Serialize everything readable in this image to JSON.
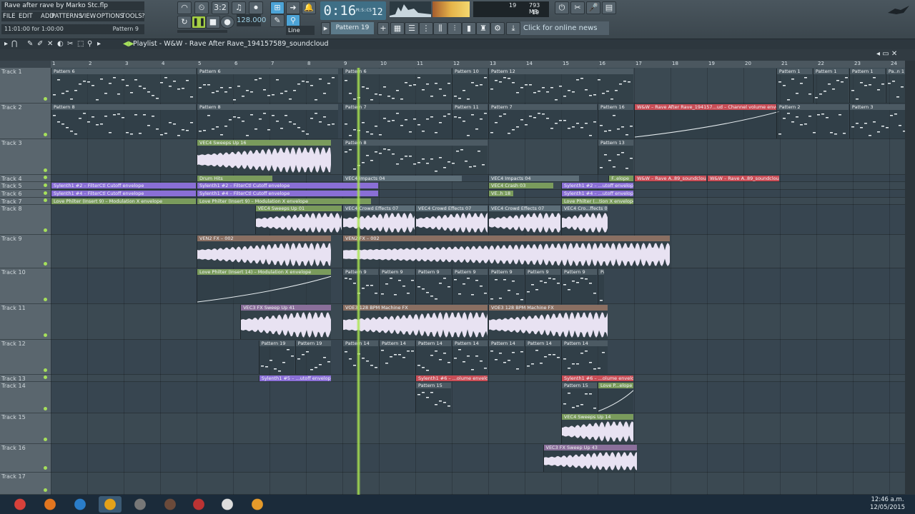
{
  "app": {
    "title": "Rave after rave by Marko Stc.flp",
    "menu": [
      "FILE",
      "EDIT",
      "ADD",
      "PATTERNS",
      "VIEW",
      "OPTIONS",
      "TOOLS",
      "?"
    ],
    "hint_time": "11:01:00 for 1:00:00",
    "hint_pattern": "Pattern 9",
    "time": "0:16",
    "time_frac": "12",
    "time_unit": "M:S:CS",
    "tempo": "128.000",
    "snap": "Line",
    "pattern_selector": "Pattern 19",
    "cpu_value": "19",
    "ram_value": "793 MB",
    "poly_value": "19",
    "news": "Click for online news",
    "step_label": "3:2"
  },
  "playlist": {
    "title": "Playlist - W&W - Rave After Rave_194157589_soundcloud",
    "ruler": [
      "1",
      "2",
      "3",
      "4",
      "5",
      "6",
      "7",
      "8",
      "9",
      "10",
      "11",
      "12",
      "13",
      "14",
      "15",
      "16",
      "17",
      "18",
      "19",
      "20",
      "21",
      "22",
      "23",
      "24"
    ],
    "tracks": [
      {
        "label": "Track 1"
      },
      {
        "label": "Track 2"
      },
      {
        "label": "Track 3"
      },
      {
        "label": "Track 4"
      },
      {
        "label": "Track 5"
      },
      {
        "label": "Track 6"
      },
      {
        "label": "Track 7"
      },
      {
        "label": "Track 8"
      },
      {
        "label": "Track 9"
      },
      {
        "label": "Track 10"
      },
      {
        "label": "Track 11"
      },
      {
        "label": "Track 12"
      },
      {
        "label": "Track 13"
      },
      {
        "label": "Track 14"
      },
      {
        "label": "Track 15"
      },
      {
        "label": "Track 16"
      },
      {
        "label": "Track 17"
      }
    ],
    "clips": [
      {
        "track": 1,
        "name": "Pattern 6",
        "color": "#4c5a63",
        "kind": "notes"
      },
      {
        "track": 1,
        "name": "Pattern 6",
        "color": "#4c5a63",
        "kind": "notes"
      },
      {
        "track": 1,
        "name": "Pattern 6",
        "color": "#4c5a63",
        "kind": "notes"
      },
      {
        "track": 1,
        "name": "Pattern 10",
        "color": "#4c5a63",
        "kind": "notes"
      },
      {
        "track": 1,
        "name": "Pattern 12",
        "color": "#4c5a63",
        "kind": "notes"
      },
      {
        "track": 1,
        "name": "Pattern 1",
        "color": "#4c5a63",
        "kind": "notes"
      },
      {
        "track": 1,
        "name": "Pattern 1",
        "color": "#4c5a63",
        "kind": "notes"
      },
      {
        "track": 1,
        "name": "Pattern 1",
        "color": "#4c5a63",
        "kind": "notes"
      },
      {
        "track": 1,
        "name": "Pa..n 1",
        "color": "#4c5a63",
        "kind": "notes"
      },
      {
        "track": 2,
        "name": "Pattern 8",
        "color": "#4c5a63",
        "kind": "notes"
      },
      {
        "track": 2,
        "name": "Pattern 8",
        "color": "#4c5a63",
        "kind": "notes"
      },
      {
        "track": 2,
        "name": "Pattern 7",
        "color": "#4c5a63",
        "kind": "notes"
      },
      {
        "track": 2,
        "name": "Pattern 11",
        "color": "#4c5a63",
        "kind": "notes"
      },
      {
        "track": 2,
        "name": "Pattern 7",
        "color": "#4c5a63",
        "kind": "notes"
      },
      {
        "track": 2,
        "name": "Pattern 16",
        "color": "#4c5a63",
        "kind": "notes"
      },
      {
        "track": 2,
        "name": "W&W – Rave After Rave_194157...ud – Channel volume envelope",
        "color": "#c94d56",
        "kind": "env"
      },
      {
        "track": 2,
        "name": "Pattern 2",
        "color": "#4c5a63",
        "kind": "notes"
      },
      {
        "track": 2,
        "name": "Pattern 3",
        "color": "#4c5a63",
        "kind": "notes"
      },
      {
        "track": 3,
        "name": "VEC4 Sweeps Up 16",
        "color": "#7a9b5c",
        "kind": "wave"
      },
      {
        "track": 3,
        "name": "Pattern 8",
        "color": "#4c5a63",
        "kind": "notes"
      },
      {
        "track": 3,
        "name": "Pattern 13",
        "color": "#4c5a63",
        "kind": "notes"
      },
      {
        "track": 4,
        "name": "Drum Hits",
        "color": "#7a9b5c",
        "kind": "none"
      },
      {
        "track": 4,
        "name": "VEC4 Impacts 04",
        "color": "#5d6e78",
        "kind": "none"
      },
      {
        "track": 4,
        "name": "VEC4 Impacts 04",
        "color": "#5d6e78",
        "kind": "none"
      },
      {
        "track": 4,
        "name": "F..elope",
        "color": "#7a9b5c",
        "kind": "none"
      },
      {
        "track": 4,
        "name": "W&W – Rave A..89_soundcloud",
        "color": "#c94d56",
        "kind": "none"
      },
      {
        "track": 4,
        "name": "W&W – Rave A..89_soundcloud",
        "color": "#c94d56",
        "kind": "none"
      },
      {
        "track": 5,
        "name": "Sylenth1 #2 – FilterCtl Cutoff envelope",
        "color": "#8a6fd6",
        "kind": "none"
      },
      {
        "track": 5,
        "name": "Sylenth1 #2 – FilterCtl Cutoff envelope",
        "color": "#8a6fd6",
        "kind": "none"
      },
      {
        "track": 5,
        "name": "VEC4 Crash 03",
        "color": "#7a9b5c",
        "kind": "none"
      },
      {
        "track": 5,
        "name": "Sylenth1 #2 – ...utoff envelope",
        "color": "#8a6fd6",
        "kind": "none"
      },
      {
        "track": 6,
        "name": "Sylenth1 #4 – FilterCtl Cutoff envelope",
        "color": "#8a6fd6",
        "kind": "none"
      },
      {
        "track": 6,
        "name": "Sylenth1 #4 – FilterCtl Cutoff envelope",
        "color": "#8a6fd6",
        "kind": "none"
      },
      {
        "track": 6,
        "name": "VE..h 18",
        "color": "#7a9b5c",
        "kind": "none"
      },
      {
        "track": 6,
        "name": "Sylenth1 #4 – ...utoff envelope",
        "color": "#8a6fd6",
        "kind": "none"
      },
      {
        "track": 7,
        "name": "Love Philter (Insert 9) – Modulation X envelope",
        "color": "#7a9b5c",
        "kind": "none"
      },
      {
        "track": 7,
        "name": "Love Philter (Insert 9) – Modulation X envelope",
        "color": "#7a9b5c",
        "kind": "none"
      },
      {
        "track": 7,
        "name": "Love Philter (...tion X envelope",
        "color": "#7a9b5c",
        "kind": "none"
      },
      {
        "track": 8,
        "name": "VEC4 Sweeps Up 01",
        "color": "#7a9b5c",
        "kind": "wave"
      },
      {
        "track": 8,
        "name": "VEC4 Crowd Effects 07",
        "color": "#5d6e78",
        "kind": "wave"
      },
      {
        "track": 8,
        "name": "VEC4 Crowd Effects 07",
        "color": "#5d6e78",
        "kind": "wave"
      },
      {
        "track": 8,
        "name": "VEC4 Crowd Effects 07",
        "color": "#5d6e78",
        "kind": "wave"
      },
      {
        "track": 8,
        "name": "VEC4 Cro...ffects 07",
        "color": "#5d6e78",
        "kind": "wave"
      },
      {
        "track": 9,
        "name": "VEN2 FX – 002",
        "color": "#8a6f62",
        "kind": "wave"
      },
      {
        "track": 9,
        "name": "VEN2 FX – 002",
        "color": "#8a6f62",
        "kind": "wave"
      },
      {
        "track": 10,
        "name": "Love Philter (Insert 14) – Modulation X envelope",
        "color": "#7a9b5c",
        "kind": "env"
      },
      {
        "track": 10,
        "name": "Pattern 9",
        "color": "#4c5a63",
        "kind": "notes"
      },
      {
        "track": 10,
        "name": "Pattern 9",
        "color": "#4c5a63",
        "kind": "notes"
      },
      {
        "track": 10,
        "name": "Pattern 9",
        "color": "#4c5a63",
        "kind": "notes"
      },
      {
        "track": 10,
        "name": "Pattern 9",
        "color": "#4c5a63",
        "kind": "notes"
      },
      {
        "track": 10,
        "name": "Pattern 9",
        "color": "#4c5a63",
        "kind": "notes"
      },
      {
        "track": 10,
        "name": "Pattern 9",
        "color": "#4c5a63",
        "kind": "notes"
      },
      {
        "track": 10,
        "name": "Pattern 9",
        "color": "#4c5a63",
        "kind": "notes"
      },
      {
        "track": 10,
        "name": "Pattern 9",
        "color": "#4c5a63",
        "kind": "notes"
      },
      {
        "track": 11,
        "name": "VEC3 FX Sweep Up 41",
        "color": "#8a6f9a",
        "kind": "wave"
      },
      {
        "track": 11,
        "name": "VOE3 128 BPM Machine FX",
        "color": "#8a6f62",
        "kind": "wave"
      },
      {
        "track": 11,
        "name": "VOE3 128 BPM Machine FX",
        "color": "#8a6f62",
        "kind": "wave"
      },
      {
        "track": 12,
        "name": "Pattern 19",
        "color": "#4c5a63",
        "kind": "notes"
      },
      {
        "track": 12,
        "name": "Pattern 19",
        "color": "#4c5a63",
        "kind": "notes"
      },
      {
        "track": 12,
        "name": "Pattern 14",
        "color": "#4c5a63",
        "kind": "notes"
      },
      {
        "track": 12,
        "name": "Pattern 14",
        "color": "#4c5a63",
        "kind": "notes"
      },
      {
        "track": 12,
        "name": "Pattern 14",
        "color": "#4c5a63",
        "kind": "notes"
      },
      {
        "track": 12,
        "name": "Pattern 14",
        "color": "#4c5a63",
        "kind": "notes"
      },
      {
        "track": 12,
        "name": "Pattern 14",
        "color": "#4c5a63",
        "kind": "notes"
      },
      {
        "track": 12,
        "name": "Pattern 14",
        "color": "#4c5a63",
        "kind": "notes"
      },
      {
        "track": 12,
        "name": "Pattern 14",
        "color": "#4c5a63",
        "kind": "notes"
      },
      {
        "track": 13,
        "name": "Sylenth1 #5 – ...utoff envelope",
        "color": "#8a6fd6",
        "kind": "none"
      },
      {
        "track": 13,
        "name": "Sylenth1 #6 – ...olume envelope",
        "color": "#c94d56",
        "kind": "none"
      },
      {
        "track": 13,
        "name": "Sylenth1 #6 – ...olume envelope",
        "color": "#c94d56",
        "kind": "none"
      },
      {
        "track": 14,
        "name": "Pattern 15",
        "color": "#4c5a63",
        "kind": "notes"
      },
      {
        "track": 14,
        "name": "Pattern 15",
        "color": "#4c5a63",
        "kind": "notes"
      },
      {
        "track": 14,
        "name": "Love P...elope",
        "color": "#7a9b5c",
        "kind": "env"
      },
      {
        "track": 15,
        "name": "VEC4 Sweeps Up 14",
        "color": "#7a9b5c",
        "kind": "wave"
      },
      {
        "track": 16,
        "name": "VEC3 FX Sweep Up 43",
        "color": "#8a6f9a",
        "kind": "wave"
      }
    ]
  },
  "taskbar": {
    "time": "12:46 a.m.",
    "date": "12/05/2015",
    "icons": [
      "chrome-icon",
      "firefox-icon",
      "store-icon",
      "fl-studio-icon",
      "app-icon-1",
      "app-icon-2",
      "app-icon-3",
      "app-icon-4",
      "app-icon-5"
    ]
  }
}
